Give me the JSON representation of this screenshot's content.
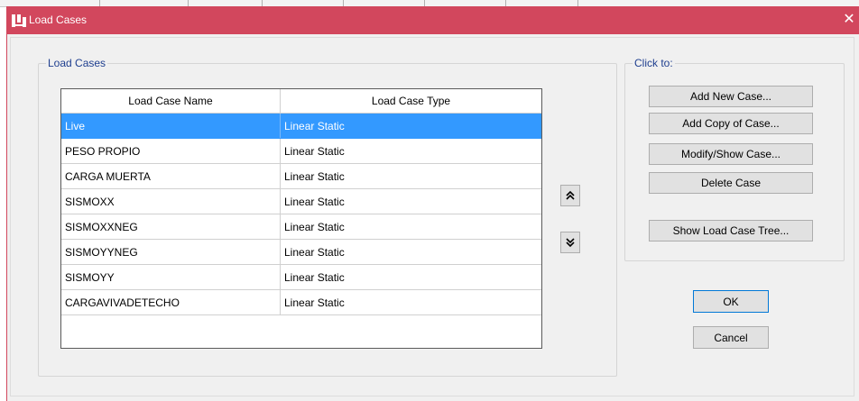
{
  "window": {
    "title": "Load Cases"
  },
  "load_cases_group": {
    "label": "Load Cases"
  },
  "table": {
    "columns": [
      "Load Case Name",
      "Load Case Type"
    ],
    "rows": [
      {
        "name": "Live",
        "type": "Linear Static",
        "selected": true
      },
      {
        "name": "PESO PROPIO",
        "type": "Linear Static"
      },
      {
        "name": "CARGA MUERTA",
        "type": "Linear Static"
      },
      {
        "name": "SISMOXX",
        "type": "Linear Static"
      },
      {
        "name": "SISMOXXNEG",
        "type": "Linear Static"
      },
      {
        "name": "SISMOYYNEG",
        "type": "Linear Static"
      },
      {
        "name": "SISMOYY",
        "type": "Linear Static"
      },
      {
        "name": "CARGAVIVADETECHO",
        "type": "Linear Static"
      }
    ]
  },
  "click_to_group": {
    "label": "Click to:",
    "add_new": "Add New Case...",
    "add_copy": "Add Copy of Case...",
    "modify_show": "Modify/Show Case...",
    "delete": "Delete Case",
    "show_tree": "Show Load Case Tree..."
  },
  "actions": {
    "ok": "OK",
    "cancel": "Cancel"
  },
  "icons": {
    "title": "app-icon",
    "close": "close-icon",
    "move_up": "double-chevron-up-icon",
    "move_down": "double-chevron-down-icon"
  },
  "colors": {
    "titlebar": "#d2475d",
    "selection": "#3399ff",
    "group_label": "#1f3f8f"
  }
}
